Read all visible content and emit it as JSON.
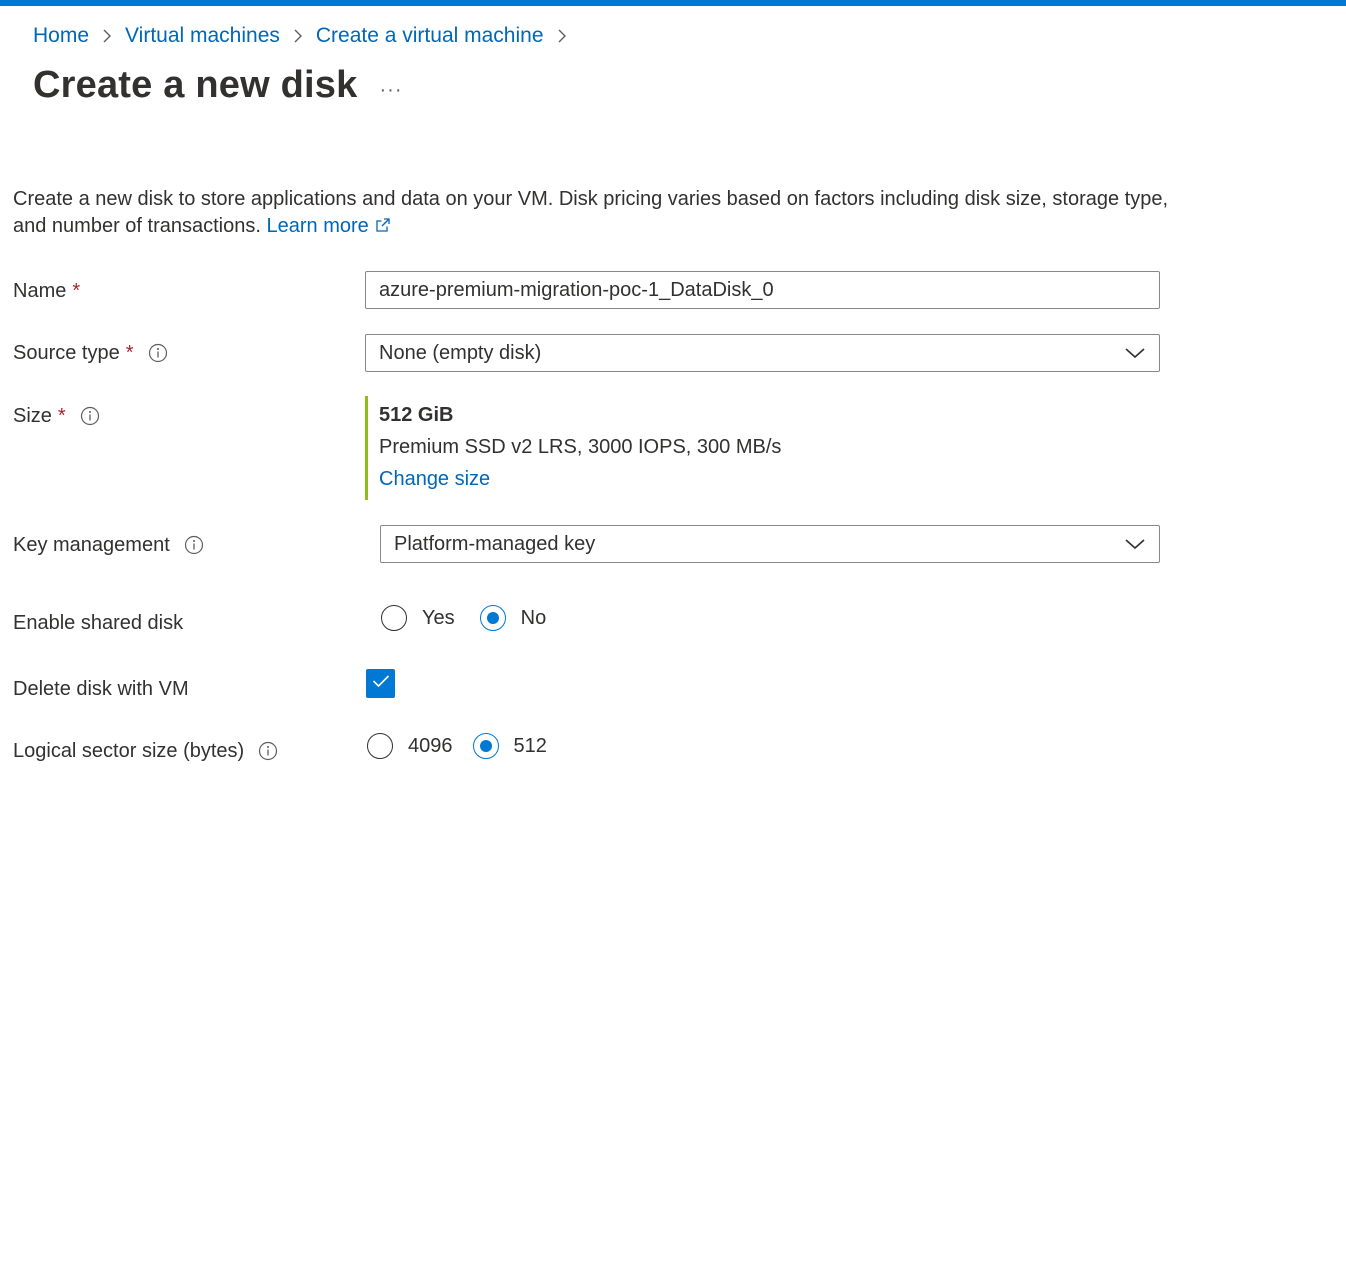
{
  "breadcrumb": {
    "items": [
      "Home",
      "Virtual machines",
      "Create a virtual machine"
    ]
  },
  "header": {
    "title": "Create a new disk",
    "more_label": "···"
  },
  "description": {
    "text": "Create a new disk to store applications and data on your VM. Disk pricing varies based on factors including disk size, storage type, and number of transactions.",
    "link_label": "Learn more"
  },
  "form": {
    "name": {
      "label": "Name",
      "required_mark": "*",
      "value": "azure-premium-migration-poc-1_DataDisk_0"
    },
    "source_type": {
      "label": "Source type",
      "required_mark": "*",
      "value": "None (empty disk)"
    },
    "size": {
      "label": "Size",
      "required_mark": "*",
      "value": "512 GiB",
      "details": "Premium SSD v2 LRS, 3000 IOPS, 300 MB/s",
      "change_label": "Change size"
    },
    "key_management": {
      "label": "Key management",
      "value": "Platform-managed key"
    },
    "shared_disk": {
      "label": "Enable shared disk",
      "options": [
        "Yes",
        "No"
      ],
      "selected": "No"
    },
    "delete_with_vm": {
      "label": "Delete disk with VM",
      "checked": true
    },
    "sector_size": {
      "label": "Logical sector size (bytes)",
      "options": [
        "4096",
        "512"
      ],
      "selected": "512"
    }
  },
  "colors": {
    "accent": "#0078d4",
    "link": "#0067b8",
    "required": "#a4262c",
    "size_bar": "#8cbd18"
  },
  "icons": {
    "breadcrumb_separator": "chevron-right-icon",
    "info": "info-icon",
    "external_link": "external-link-icon",
    "dropdown": "chevron-down-icon",
    "checkbox": "checkmark-icon"
  }
}
